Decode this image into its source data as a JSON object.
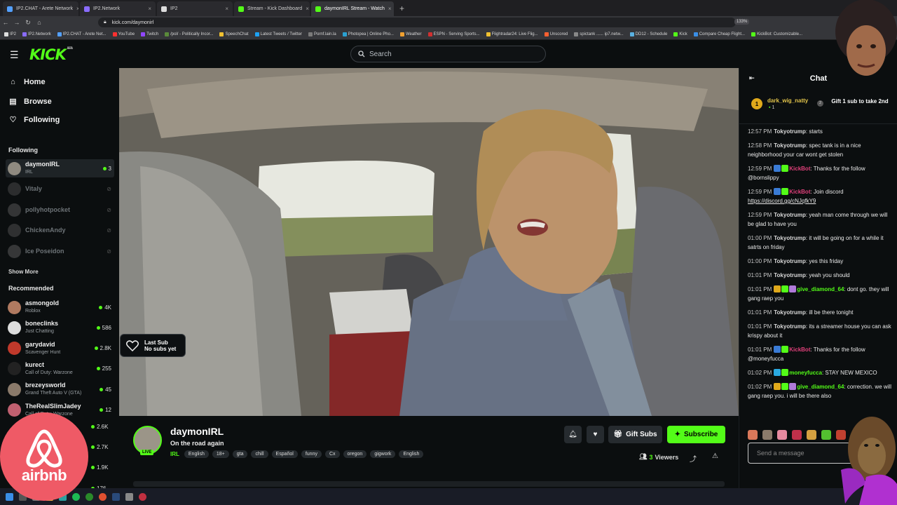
{
  "browser": {
    "tabs": [
      {
        "label": "IP2.CHAT - Arete Network",
        "fav": "#53a0ff"
      },
      {
        "label": "IP2.Network",
        "fav": "#8a6cff"
      },
      {
        "label": "IP2",
        "fav": "#dddddd"
      },
      {
        "label": "Stream - Kick Dashboard",
        "fav": "#53fc18"
      },
      {
        "label": "daymonIRL Stream - Watch",
        "fav": "#53fc18"
      }
    ],
    "new_tab": "+",
    "url": "kick.com/daymonirl",
    "zoom": "133%",
    "bookmarks": [
      "IP2",
      "IP2.Network",
      "IP2.CHAT - Arete Net...",
      "YouTube",
      "Twitch",
      "/pol/ - Politically Incor...",
      "SpeechChat",
      "Latest Tweets / Twitter",
      "Pornf.lain.la",
      "Photopea | Online Pho...",
      "Weather",
      "ESPN - Serving Sports...",
      "Flightradar24: Live Flig...",
      "Unscored",
      "spictank ...... ip7.netw...",
      "DD12 - Schedule",
      "Kick",
      "Compare Cheap Flight...",
      "KickBot: Customizable..."
    ]
  },
  "header": {
    "logo": "KICK",
    "logo_beta": "BETA",
    "search_placeholder": "Search"
  },
  "nav": {
    "home": "Home",
    "browse": "Browse",
    "following": "Following"
  },
  "sidebar": {
    "following_title": "Following",
    "following": [
      {
        "name": "daymonIRL",
        "sub": "IRL",
        "viewers": "3",
        "live": true,
        "color": "#8f8a80"
      },
      {
        "name": "Vitaly",
        "sub": "",
        "viewers": "",
        "live": false,
        "color": "#555555"
      },
      {
        "name": "pollyhotpocket",
        "sub": "",
        "viewers": "",
        "live": false,
        "color": "#666666"
      },
      {
        "name": "ChickenAndy",
        "sub": "",
        "viewers": "",
        "live": false,
        "color": "#5a5a5a"
      },
      {
        "name": "Ice Poseidon",
        "sub": "",
        "viewers": "",
        "live": false,
        "color": "#6a6a6a"
      }
    ],
    "show_more": "Show More",
    "recommended_title": "Recommended",
    "recommended": [
      {
        "name": "asmongold",
        "sub": "Roblox",
        "viewers": "4K",
        "color": "#b07a60"
      },
      {
        "name": "boneclinks",
        "sub": "Just Chatting",
        "viewers": "586",
        "color": "#dddddd"
      },
      {
        "name": "garydavid",
        "sub": "Scavenger Hunt",
        "viewers": "2.8K",
        "color": "#c0392b"
      },
      {
        "name": "kurect",
        "sub": "Call of Duty: Warzone",
        "viewers": "255",
        "color": "#222222"
      },
      {
        "name": "brezeysworld",
        "sub": "Grand Theft Auto V (GTA)",
        "viewers": "45",
        "color": "#8a7a6a"
      },
      {
        "name": "TheRealSlimJadey",
        "sub": "Call of Duty: Warzone",
        "viewers": "12",
        "color": "#c06070"
      }
    ],
    "extra_viewers": [
      "2.6K",
      "2.7K",
      "1.9K",
      "176"
    ]
  },
  "video": {
    "last_sub_title": "Last Sub",
    "last_sub_value": "No subs yet"
  },
  "stream": {
    "streamer": "daymonIRL",
    "live_badge": "LIVE",
    "title": "On the road again",
    "category": "IRL",
    "tags": [
      "English",
      "18+",
      "gta",
      "chill",
      "Español",
      "funny",
      "Cx",
      "oregon",
      "gigwork",
      "English"
    ],
    "gift_label": "Gift Subs",
    "subscribe_label": "Subscribe",
    "viewers_count": "3",
    "viewers_label": "Viewers"
  },
  "chat": {
    "title": "Chat",
    "pinned_user": "dark_wig_natty",
    "pinned_rank": "1",
    "pinned_count": "1",
    "pinned_gift": "Gift 1 sub to take 2nd",
    "messages": [
      {
        "ts": "12:57 PM",
        "user": "Tokyotrump",
        "cls": "u-toky",
        "badges": [],
        "text": "starts"
      },
      {
        "ts": "12:58 PM",
        "user": "Tokyotrump",
        "cls": "u-toky",
        "badges": [],
        "text": "spec tank is in a nice neighborhood your car wont get stolen"
      },
      {
        "ts": "12:59 PM",
        "user": "KickBot",
        "cls": "u-bot",
        "badges": [
          "#3a7bd5",
          "#53fc18"
        ],
        "text": "Thanks for the follow @bornslippy"
      },
      {
        "ts": "12:59 PM",
        "user": "KickBot",
        "cls": "u-bot",
        "badges": [
          "#3a7bd5",
          "#53fc18"
        ],
        "text": "Join discord ",
        "link": "https://discord.gg/cNJqfkY9"
      },
      {
        "ts": "12:59 PM",
        "user": "Tokyotrump",
        "cls": "u-toky",
        "badges": [],
        "text": "yeah man come through we will be glad to have you"
      },
      {
        "ts": "01:00 PM",
        "user": "Tokyotrump",
        "cls": "u-toky",
        "badges": [],
        "text": "it will be going on for a while it satrts on friday"
      },
      {
        "ts": "01:00 PM",
        "user": "Tokyotrump",
        "cls": "u-toky",
        "badges": [],
        "text": "yes this friday"
      },
      {
        "ts": "01:01 PM",
        "user": "Tokyotrump",
        "cls": "u-toky",
        "badges": [],
        "text": "yeah you should"
      },
      {
        "ts": "01:01 PM",
        "user": "give_diamond_64",
        "cls": "u-dia",
        "badges": [
          "#e0a91b",
          "#53fc18",
          "#b07ad9"
        ],
        "text": "dont go. they will gang raep you"
      },
      {
        "ts": "01:01 PM",
        "user": "Tokyotrump",
        "cls": "u-toky",
        "badges": [],
        "text": "ill be there tonight"
      },
      {
        "ts": "01:01 PM",
        "user": "Tokyotrump",
        "cls": "u-toky",
        "badges": [],
        "text": "its a streamer house you can ask krispy about it"
      },
      {
        "ts": "01:01 PM",
        "user": "KickBot",
        "cls": "u-bot",
        "badges": [
          "#3a7bd5",
          "#53fc18"
        ],
        "text": "Thanks for the follow @moneyfucca"
      },
      {
        "ts": "01:02 PM",
        "user": "moneyfucca",
        "cls": "u-money",
        "badges": [
          "#2aa9e0",
          "#53fc18"
        ],
        "text": "STAY NEW MEXICO"
      },
      {
        "ts": "01:02 PM",
        "user": "give_diamond_64",
        "cls": "u-dia",
        "badges": [
          "#e0a91b",
          "#53fc18",
          "#b07ad9"
        ],
        "text": "correction. we will gang raep you. i will be there also"
      }
    ],
    "input_placeholder": "Send a message"
  },
  "overlay": {
    "airbnb": "airbnb"
  },
  "colors": {
    "accent": "#53fc18",
    "background": "#0b0e0f"
  }
}
